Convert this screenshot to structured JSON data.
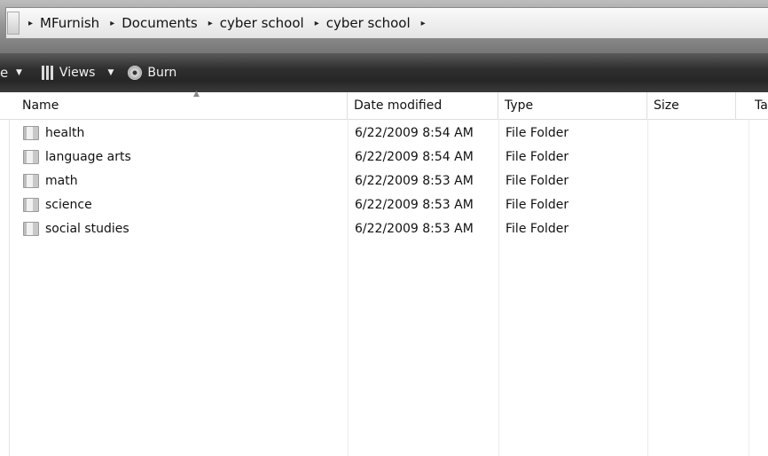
{
  "breadcrumb": [
    "MFurnish",
    "Documents",
    "cyber school",
    "cyber school"
  ],
  "breadcrumb_separator": "▸",
  "toolbar": {
    "partial_label": "e",
    "views_label": "Views",
    "burn_label": "Burn"
  },
  "columns": {
    "name": "Name",
    "date": "Date modified",
    "type": "Type",
    "size": "Size",
    "tags": "Ta"
  },
  "files": [
    {
      "name": "health",
      "date": "6/22/2009 8:54 AM",
      "type": "File Folder",
      "icon": "folder-icon"
    },
    {
      "name": "language arts",
      "date": "6/22/2009 8:54 AM",
      "type": "File Folder",
      "icon": "folder-icon"
    },
    {
      "name": "math",
      "date": "6/22/2009 8:53 AM",
      "type": "File Folder",
      "icon": "folder-icon"
    },
    {
      "name": "science",
      "date": "6/22/2009 8:53 AM",
      "type": "File Folder",
      "icon": "folder-icon"
    },
    {
      "name": "social studies",
      "date": "6/22/2009 8:53 AM",
      "type": "File Folder",
      "icon": "folder-icon"
    }
  ]
}
